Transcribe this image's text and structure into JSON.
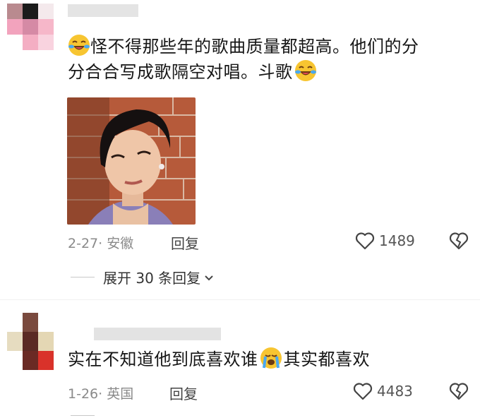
{
  "comments": [
    {
      "line1": "怪不得那些年的歌曲质量都超高。他们的分",
      "line2": "分合合写成歌隔空对唱。斗歌",
      "date": "2-27",
      "location": "安徽",
      "reply_label": "回复",
      "likes": "1489",
      "expand_label": "展开 30 条回复"
    },
    {
      "text_before": "实在不知道他到底喜欢谁",
      "text_after": "其实都喜欢",
      "date": "1-26",
      "location": "英国",
      "reply_label": "回复",
      "likes": "4483"
    }
  ],
  "icons": [
    "laughing-crying-emoji",
    "heart-icon",
    "broken-heart-icon",
    "chevron-down-icon",
    "crying-emoji"
  ],
  "colors": {
    "avatar_pink": "#f4a9c0",
    "emoji_yellow": "#f7c531",
    "text": "#161616",
    "meta": "#8a8a8a"
  }
}
